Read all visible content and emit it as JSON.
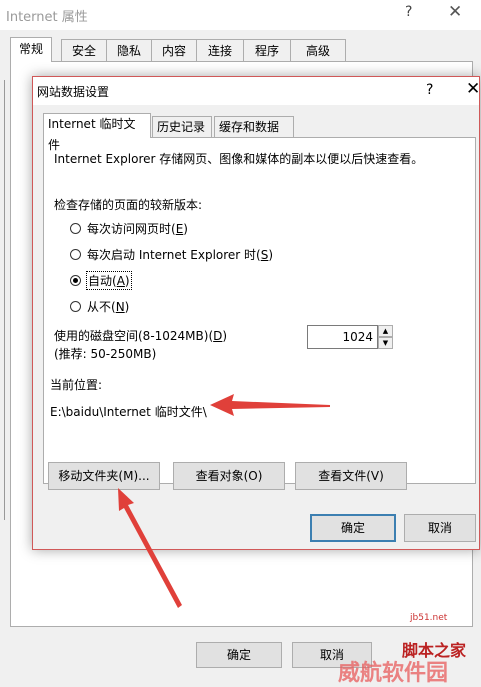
{
  "outer_window": {
    "title": "Internet 属性",
    "help": "?",
    "close": "✕",
    "tabs": [
      "常规",
      "安全",
      "隐私",
      "内容",
      "连接",
      "程序",
      "高级"
    ],
    "ok_label": "确定",
    "cancel_label": "取消"
  },
  "dialog": {
    "title": "网站数据设置",
    "help": "?",
    "close": "✕",
    "tabs": [
      "Internet 临时文件",
      "历史记录",
      "缓存和数据库"
    ],
    "description": "Internet Explorer 存储网页、图像和媒体的副本以便以后快速查看。",
    "check_label": "检查存储的页面的较新版本:",
    "radio_options": [
      {
        "label": "每次访问网页时(",
        "key": "E",
        "suffix": ")",
        "checked": false
      },
      {
        "label": "每次启动 Internet Explorer 时(",
        "key": "S",
        "suffix": ")",
        "checked": false
      },
      {
        "label": "自动(",
        "key": "A",
        "suffix": ")",
        "checked": true
      },
      {
        "label": "从不(",
        "key": "N",
        "suffix": ")",
        "checked": false
      }
    ],
    "disk_label": "使用的磁盘空间(8-1024MB)(",
    "disk_key": "D",
    "disk_suffix": ")",
    "disk_recommend": "(推荐: 50-250MB)",
    "disk_value": "1024",
    "location_label": "当前位置:",
    "location_path": "E:\\baidu\\Internet 临时文件\\",
    "buttons": {
      "move_folder": "移动文件夹(M)...",
      "view_objects": "查看对象(O)",
      "view_files": "查看文件(V)",
      "ok": "确定",
      "cancel": "取消"
    }
  },
  "annotation_color": "#e0403a",
  "watermark": {
    "site": "脚本之家",
    "domain": "jb51.net",
    "overlay": "威航软件园"
  }
}
